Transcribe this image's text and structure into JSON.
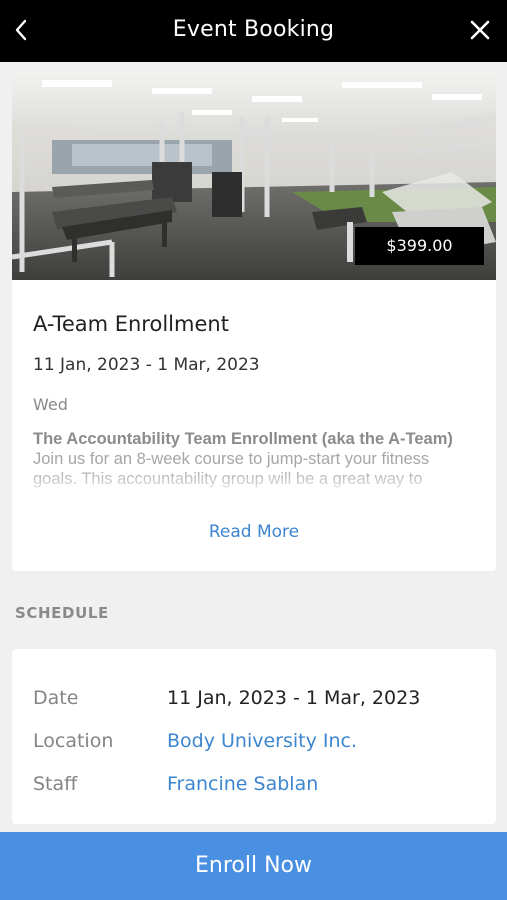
{
  "header": {
    "title": "Event Booking",
    "back_icon": "chevron-left-icon",
    "close_icon": "close-icon"
  },
  "event": {
    "image_alt": "gym interior",
    "price": "$399.00",
    "title": "A-Team Enrollment",
    "dates": "11 Jan, 2023 - 1 Mar, 2023",
    "day": "Wed",
    "description_heading": "The Accountability Team Enrollment (aka the A-Team)",
    "description_body": "Join us for an 8-week course to jump-start your fitness goals. This accountability group will be a great way to",
    "read_more": "Read More"
  },
  "schedule": {
    "section_label": "SCHEDULE",
    "rows": [
      {
        "label": "Date",
        "value": "11 Jan, 2023 - 1 Mar, 2023"
      },
      {
        "label": "Location",
        "value": "Body University Inc."
      },
      {
        "label": "Staff",
        "value": "Francine Sablan"
      }
    ]
  },
  "actions": {
    "enroll_label": "Enroll Now"
  },
  "colors": {
    "header_bg": "#000000",
    "link": "#3d86cf",
    "enroll_bg": "#4a90e2",
    "page_bg": "#f0f0f0"
  }
}
